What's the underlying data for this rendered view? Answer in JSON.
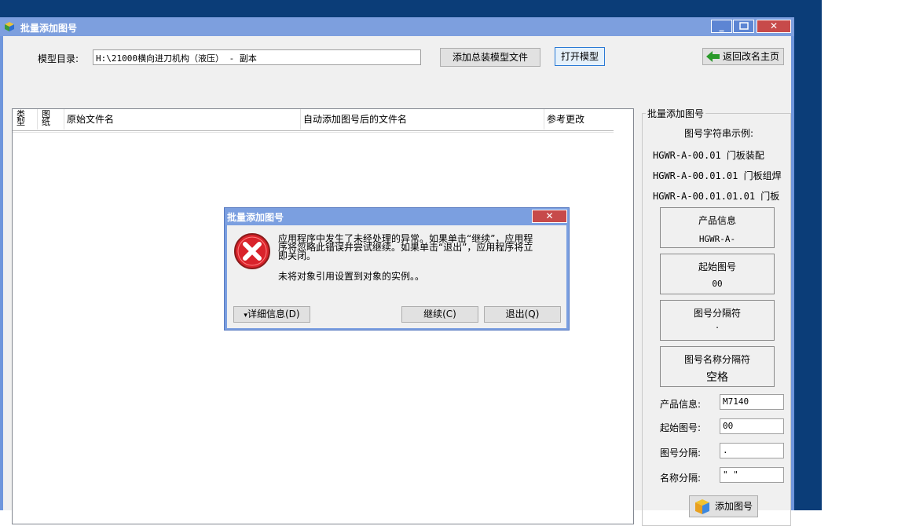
{
  "window": {
    "title": "批量添加图号"
  },
  "toolbar": {
    "model_dir_label": "模型目录:",
    "model_dir_value": "H:\\21000横向进刀机构（液压） - 副本",
    "add_assembly_label": "添加总装模型文件",
    "open_model_label": "打开模型",
    "back_label": "返回改名主页"
  },
  "list": {
    "columns": [
      "类型",
      "图纸",
      "原始文件名",
      "自动添加图号后的文件名",
      "参考更改"
    ]
  },
  "panel": {
    "group_title": "批量添加图号",
    "example_title": "图号字符串示例:",
    "examples": [
      "HGWR-A-00.01 门板装配",
      "HGWR-A-00.01.01 门板组焊",
      "HGWR-A-00.01.01.01 门板"
    ],
    "product_info_title": "产品信息",
    "product_info_value": "HGWR-A-",
    "start_no_title": "起始图号",
    "start_no_value": "00",
    "separator_title": "图号分隔符",
    "separator_value": ".",
    "name_sep_title": "图号名称分隔符",
    "name_sep_value": "空格",
    "form": {
      "product_label": "产品信息:",
      "product_value": "M7140",
      "start_label": "起始图号:",
      "start_value": "00",
      "sep_label": "图号分隔:",
      "sep_value": ".",
      "name_sep_label": "名称分隔:",
      "name_sep_value": "\" \""
    },
    "add_button_label": "添加图号"
  },
  "dialog": {
    "title": "批量添加图号",
    "message_lines": [
      "应用程序中发生了未经处理的异常。如果单击“继续”，应用程",
      "序将忽略此错误并尝试继续。如果单击“退出”，应用程序将立",
      "即关闭。"
    ],
    "detail_message": "未将对象引用设置到对象的实例。。",
    "details_button": "详细信息(D)",
    "continue_button": "继续(C)",
    "quit_button": "退出(Q)"
  },
  "colors": {
    "desktop": "#0b3d78",
    "titlebar": "#7d9fde",
    "close": "#c74a4a",
    "error_icon": "#d9232b"
  }
}
